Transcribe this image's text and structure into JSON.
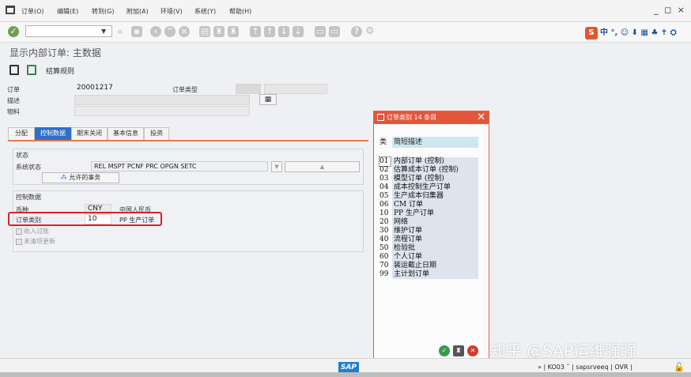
{
  "menu": {
    "items": [
      "订单(O)",
      "编辑(E)",
      "转到(G)",
      "附加(A)",
      "环境(V)",
      "系统(Y)",
      "帮助(H)"
    ],
    "window_controls": "_ ◻ ×"
  },
  "toolbar": {
    "command_field_value": "",
    "ime_text": "中 °, ☺ ⬇ ▦ ♣ ✝ ⛭"
  },
  "page": {
    "title": "显示内部订单: 主数据",
    "structure_button_label": "结算规则"
  },
  "header": {
    "order_label": "订单",
    "order_value": "20001217",
    "order_type_label": "订单类型",
    "desc_label": "描述",
    "material_label": "物料"
  },
  "tabs": [
    "分配",
    "控制数据",
    "期末关闭",
    "基本信息",
    "投资"
  ],
  "status_section": {
    "title": "状态",
    "system_status_label": "系统状态",
    "system_status_value": "REL  MSPT PCNF PRC  OPGN SETC",
    "allowed_tx_label": "允许的事务"
  },
  "control_section": {
    "title": "控制数据",
    "currency_label": "币种",
    "currency_code": "CNY",
    "currency_name": "中国人民币",
    "order_category_label": "订单类别",
    "order_category_code": "10",
    "order_category_text": "PP 生产订单",
    "revenue_label": "收入过账",
    "commitment_label": "未清项更新"
  },
  "popup": {
    "title": "订单类别 14 条目",
    "col_key": "类",
    "col_desc": "简短描述",
    "rows": [
      {
        "k": "01",
        "v": "内部订单 (控制)"
      },
      {
        "k": "02",
        "v": "估算成本订单 (控制)"
      },
      {
        "k": "03",
        "v": "模型订单 (控制)"
      },
      {
        "k": "04",
        "v": "成本控制生产订单"
      },
      {
        "k": "05",
        "v": "生产成本归集器"
      },
      {
        "k": "06",
        "v": "CM 订单"
      },
      {
        "k": "10",
        "v": "PP 生产订单"
      },
      {
        "k": "20",
        "v": "网络"
      },
      {
        "k": "30",
        "v": "维护订单"
      },
      {
        "k": "40",
        "v": "流程订单"
      },
      {
        "k": "50",
        "v": "检验批"
      },
      {
        "k": "60",
        "v": "个人订单"
      },
      {
        "k": "70",
        "v": "装运截止日期"
      },
      {
        "k": "99",
        "v": "主计划订单"
      }
    ]
  },
  "statusbar": {
    "logo": "SAP",
    "info": "»  | KO03  ˇ  | sapsrveeq | OVR |"
  },
  "watermark": "知乎 @SAP运维强强",
  "colors": {
    "accent_orange": "#e2563a",
    "tab_active": "#2f6fc7",
    "highlight_red": "#d8232a"
  }
}
